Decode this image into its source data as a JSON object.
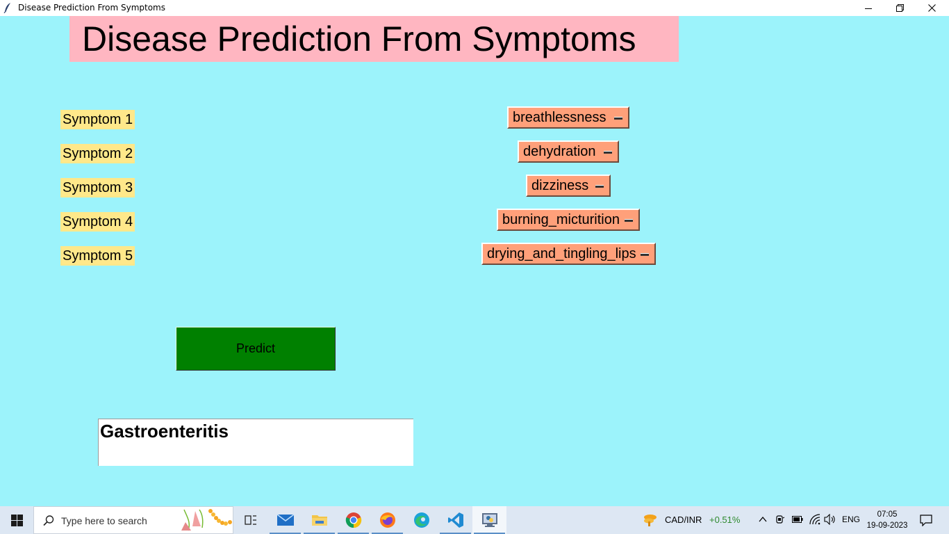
{
  "window": {
    "title": "Disease Prediction From Symptoms"
  },
  "app": {
    "heading": "Disease Prediction From Symptoms",
    "symptoms": [
      {
        "label": "Symptom 1",
        "value": "breathlessness"
      },
      {
        "label": "Symptom 2",
        "value": "dehydration"
      },
      {
        "label": "Symptom 3",
        "value": "dizziness"
      },
      {
        "label": "Symptom 4",
        "value": "burning_micturition"
      },
      {
        "label": "Symptom 5",
        "value": "drying_and_tingling_lips"
      }
    ],
    "predict_label": "Predict",
    "result": "Gastroenteritis",
    "colors": {
      "background": "#9cf3fb",
      "heading_bg": "#ffb6c1",
      "label_bg": "#ffe88a",
      "menu_bg": "#ffa07a",
      "predict_bg": "#008000"
    }
  },
  "taskbar": {
    "search_placeholder": "Type here to search",
    "apps": [
      "task-view-icon",
      "mail-icon",
      "file-explorer-icon",
      "chrome-icon",
      "firefox-icon",
      "edge-icon",
      "vscode-icon",
      "python-idle-icon"
    ],
    "ticker": {
      "symbol": "CAD/INR",
      "change": "+0.51%",
      "change_color": "#2f8a2f"
    },
    "language": "ENG",
    "time": "07:05",
    "date": "19-09-2023"
  }
}
